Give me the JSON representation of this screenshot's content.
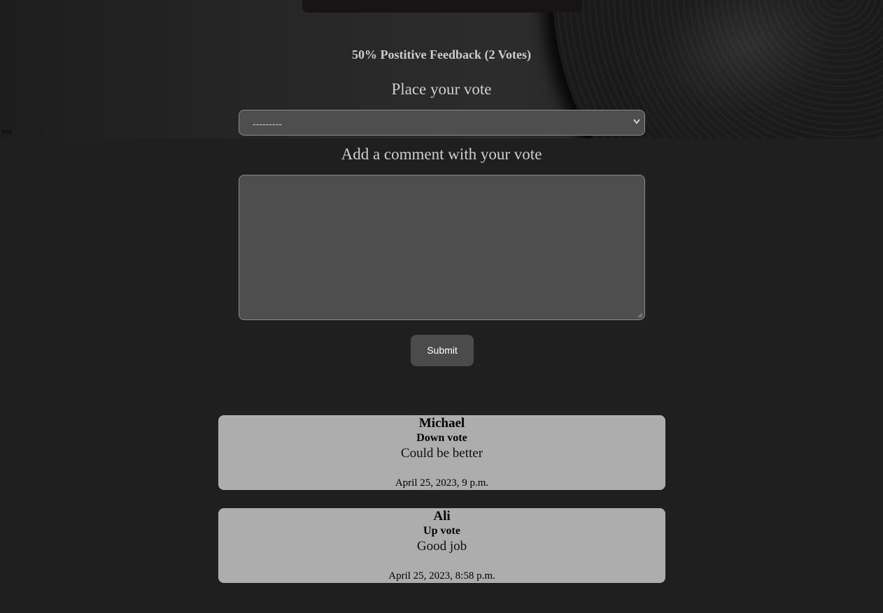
{
  "rating": {
    "summary": "50% Postitive Feedback (2 Votes)"
  },
  "vote_form": {
    "vote_label": "Place your vote",
    "vote_select_value": "---------",
    "comment_label": "Add a comment with your vote",
    "comment_value": "",
    "submit_label": "Submit"
  },
  "corner_mark": "rk:wi",
  "reviews": [
    {
      "name": "Michael",
      "vote": "Down vote",
      "comment": "Could be better",
      "timestamp": "April 25, 2023, 9 p.m."
    },
    {
      "name": "Ali",
      "vote": "Up vote",
      "comment": "Good job",
      "timestamp": "April 25, 2023, 8:58 p.m."
    }
  ],
  "colors": {
    "page_background": "#1f1f1f",
    "input_background": "#4e4e4e",
    "card_background": "#adadad",
    "button_background": "#4b4b4b"
  }
}
